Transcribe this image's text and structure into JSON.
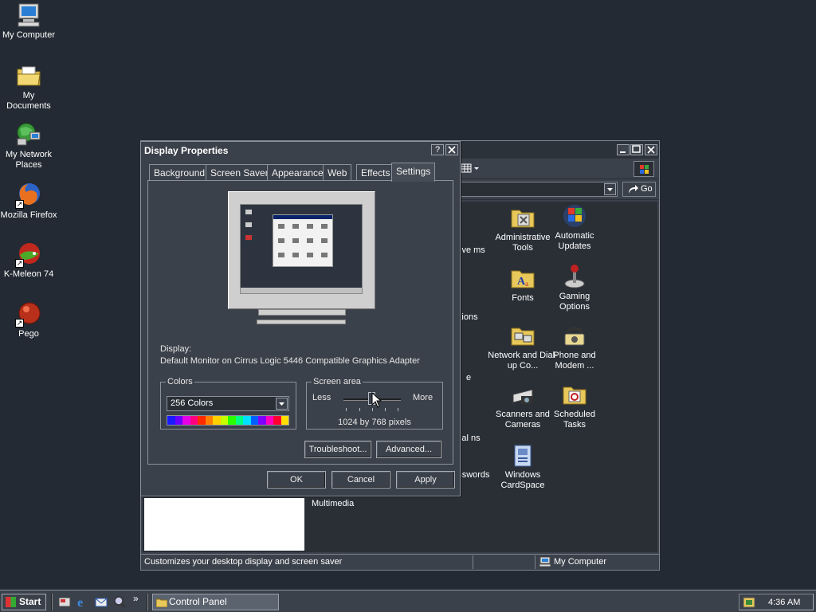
{
  "desktop": {
    "icons": [
      {
        "label": "My Computer"
      },
      {
        "label": "My Documents"
      },
      {
        "label": "My Network Places"
      },
      {
        "label": "Mozilla Firefox"
      },
      {
        "label": "K-Meleon 74"
      },
      {
        "label": "Pego"
      }
    ]
  },
  "control_panel": {
    "go_label": "Go",
    "items": [
      {
        "label": "nove ms"
      },
      {
        "label": "Administrative Tools"
      },
      {
        "label": "Automatic Updates"
      },
      {
        "label": "tions"
      },
      {
        "label": "Fonts"
      },
      {
        "label": "Gaming Options"
      },
      {
        "label": "e"
      },
      {
        "label": "Network and Dial-up Co..."
      },
      {
        "label": "Phone and Modem ..."
      },
      {
        "label": "nal ns"
      },
      {
        "label": "Scanners and Cameras"
      },
      {
        "label": "Scheduled Tasks"
      },
      {
        "label": "Multimedia"
      },
      {
        "label": "nd Passwords"
      },
      {
        "label": "Windows CardSpace"
      }
    ],
    "status_text": "Customizes your desktop display and screen saver",
    "status_zone": "My Computer"
  },
  "dialog": {
    "title": "Display Properties",
    "help_glyph": "?",
    "close_glyph": "✕",
    "tabs": [
      {
        "label": "Background"
      },
      {
        "label": "Screen Saver"
      },
      {
        "label": "Appearance"
      },
      {
        "label": "Web"
      },
      {
        "label": "Effects"
      },
      {
        "label": "Settings"
      }
    ],
    "active_tab": "Settings",
    "display_label": "Display:",
    "display_value": "Default Monitor on Cirrus Logic 5446 Compatible Graphics Adapter",
    "colors": {
      "group_label": "Colors",
      "selected": "256 Colors",
      "spectrum": [
        "#1a1aff",
        "#6a00ff",
        "#e600e6",
        "#ff0080",
        "#ff2a00",
        "#ff8000",
        "#ffd000",
        "#c8ff00",
        "#2aff00",
        "#00ff80",
        "#00e0ff",
        "#0060ff",
        "#8000ff",
        "#ff00c0",
        "#ff0030",
        "#ffe000"
      ]
    },
    "screen_area": {
      "group_label": "Screen area",
      "less_label": "Less",
      "more_label": "More",
      "resolution": "1024 by 768 pixels",
      "slider_position": 0.5
    },
    "buttons": {
      "troubleshoot": "Troubleshoot...",
      "advanced": "Advanced...",
      "ok": "OK",
      "cancel": "Cancel",
      "apply": "Apply"
    }
  },
  "taskbar": {
    "start_label": "Start",
    "chevron": "»",
    "tasks": [
      {
        "label": "Control Panel"
      }
    ],
    "clock": "4:36 AM"
  },
  "colors": {
    "desktop_bg": "#232a33",
    "window_face": "#3b414a",
    "window_border": "#8a929d",
    "text": "#e6e6e6"
  }
}
